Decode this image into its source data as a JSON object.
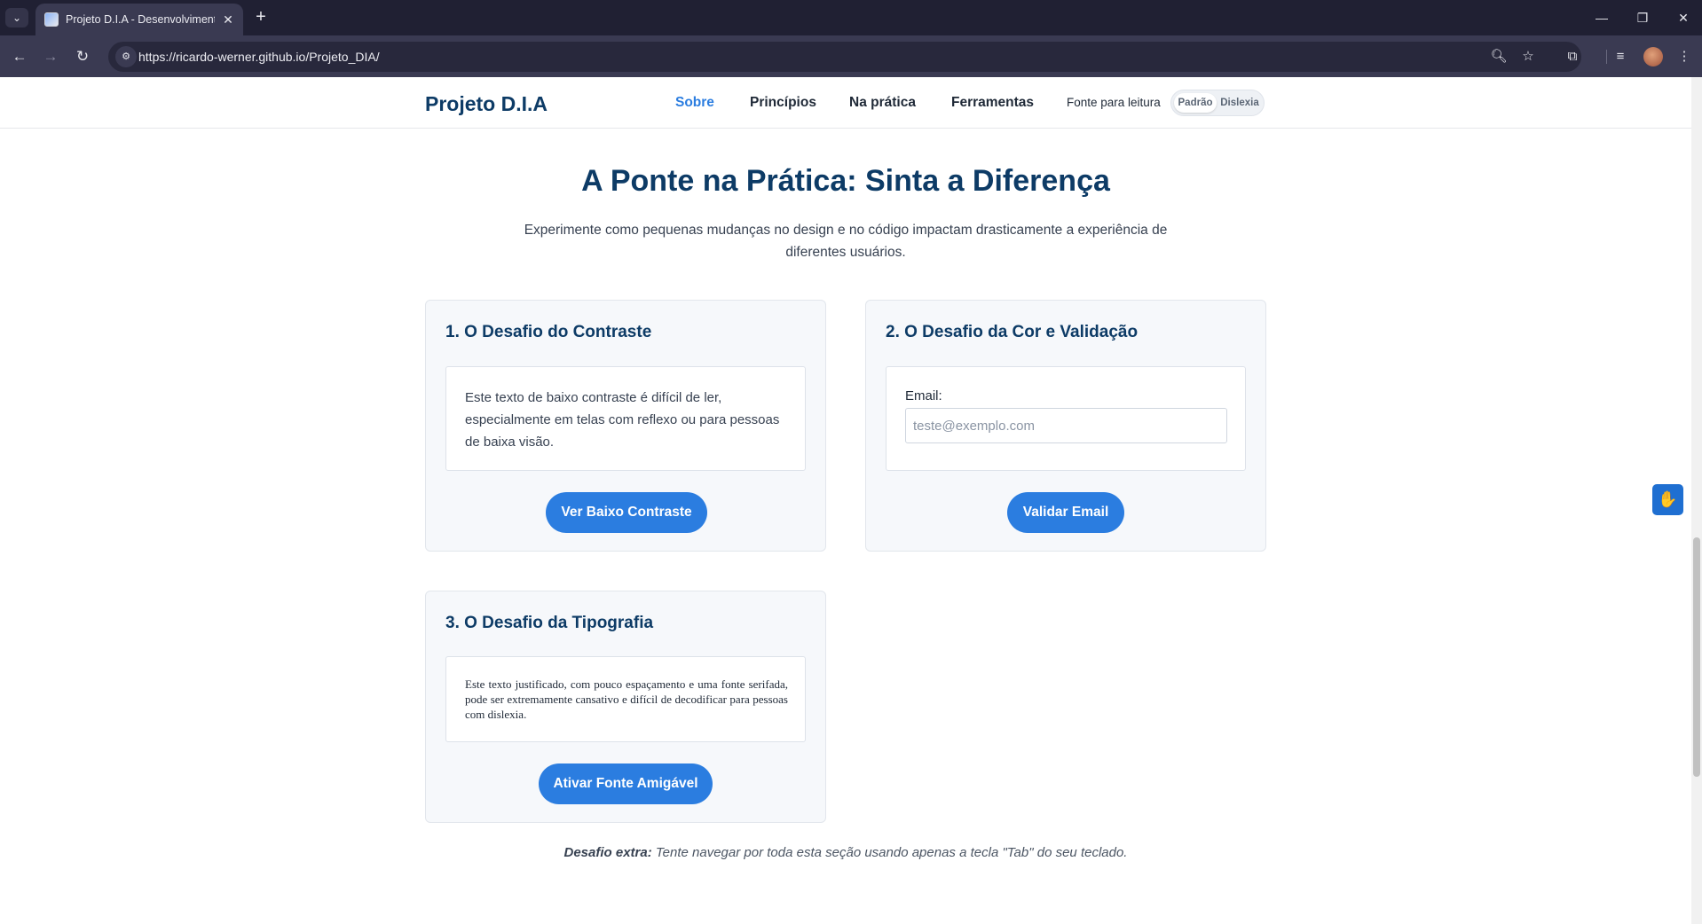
{
  "browser": {
    "tab_title": "Projeto D.I.A - Desenvolvimento",
    "tab_close": "✕",
    "new_tab": "+",
    "url": "https://ricardo-werner.github.io/Projeto_DIA/",
    "icons": [
      "tab-list-icon",
      "back-icon",
      "forward-icon",
      "reload-icon",
      "site-info-icon",
      "zoom-icon",
      "star-icon",
      "extensions-icon",
      "media-controls-icon",
      "profile-avatar",
      "menu-icon",
      "minimize-icon",
      "restore-icon",
      "close-icon"
    ]
  },
  "header": {
    "brand": "Projeto D.I.A",
    "nav": {
      "sobre": "Sobre",
      "principios": "Princípios",
      "na_pratica": "Na prática",
      "ferramentas": "Ferramentas"
    },
    "font_label": "Fonte para leitura",
    "font_options": {
      "padrao": "Padrão",
      "dislexia": "Dislexia"
    },
    "font_selected": "Padrão"
  },
  "section": {
    "title": "A Ponte na Prática: Sinta a Diferença",
    "subtitle": "Experimente como pequenas mudanças no design e no código impactam drasticamente a experiência de diferentes usuários."
  },
  "cards": {
    "contrast": {
      "title": "1. O Desafio do Contraste",
      "text": "Este texto de baixo contraste é difícil de ler, especialmente em telas com reflexo ou para pessoas de baixa visão.",
      "button": "Ver Baixo Contraste"
    },
    "color": {
      "title": "2. O Desafio da Cor e Validação",
      "email_label": "Email:",
      "email_value": "",
      "email_placeholder": "teste@exemplo.com",
      "button": "Validar Email"
    },
    "typography": {
      "title": "3. O Desafio da Tipografia",
      "text": "Este texto justificado, com pouco espaçamento e uma fonte serifada, pode ser extremamente cansativo e difícil de decodificar para pessoas com dislexia.",
      "button": "Ativar Fonte Amigável"
    }
  },
  "extra": {
    "label": "Desafio extra:",
    "text": " Tente navegar por toda esta seção usando apenas a tecla \"Tab\" do seu teclado."
  },
  "colors": {
    "brand": "#0d3b66",
    "accent": "#2b7de0",
    "browser_dark": "#202033"
  }
}
